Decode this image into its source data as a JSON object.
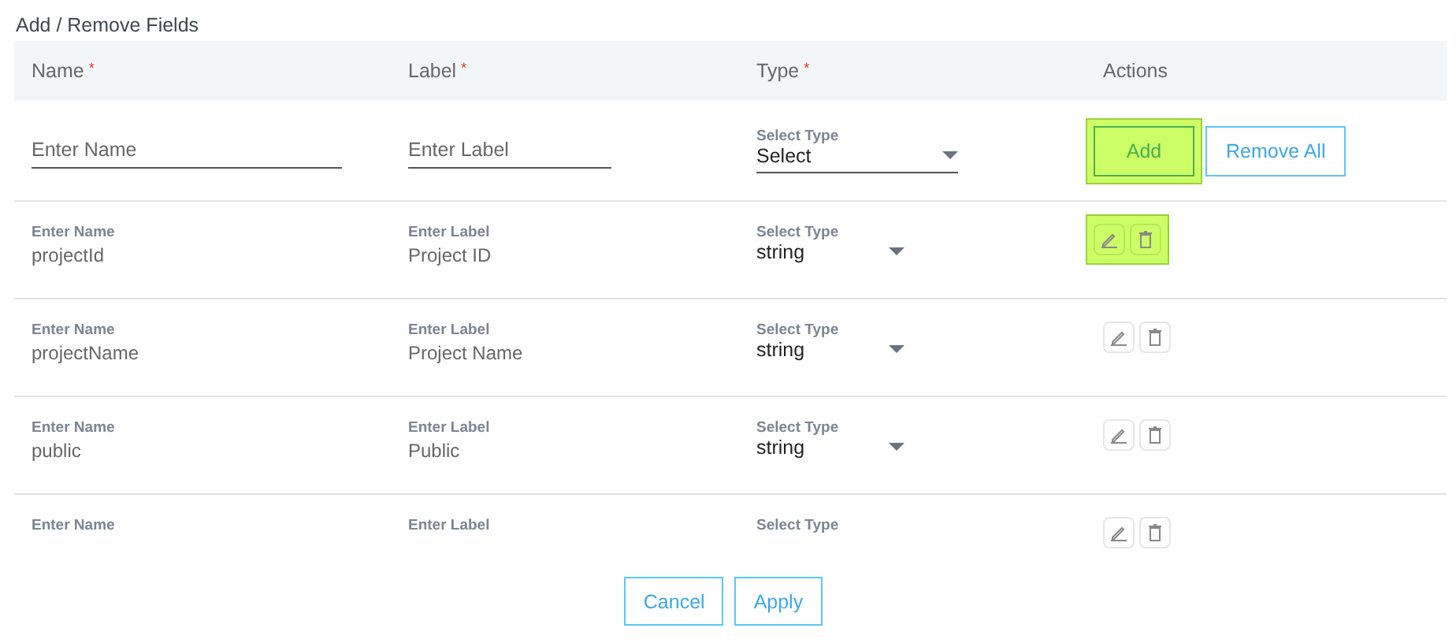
{
  "title": "Add / Remove Fields",
  "columns": [
    {
      "label": "Name",
      "mark": "*"
    },
    {
      "label": "Label",
      "mark": "*"
    },
    {
      "label": "Type",
      "mark": "*"
    },
    {
      "label": "Actions"
    }
  ],
  "new_field": {
    "name_placeholder": "Enter Name",
    "label_placeholder": "Enter Label",
    "type_label": "Select Type",
    "type_value": "Select",
    "buttons": [
      {
        "label": "Add",
        "kind": "primary",
        "highlighted": true
      },
      {
        "label": "Remove All",
        "kind": "outline",
        "highlighted": false
      }
    ]
  },
  "rows": [
    {
      "name_caption": "Enter Name",
      "name": "projectId",
      "label_caption": "Enter Label",
      "label": "Project ID",
      "type_caption": "Select Type",
      "type": "string",
      "highlighted": true
    },
    {
      "name_caption": "Enter Name",
      "name": "projectName",
      "label_caption": "Enter Label",
      "label": "Project Name",
      "type_caption": "Select Type",
      "type": "string",
      "highlighted": false
    },
    {
      "name_caption": "Enter Name",
      "name": "public",
      "label_caption": "Enter Label",
      "label": "Public",
      "type_caption": "Select Type",
      "type": "string",
      "highlighted": false
    },
    {
      "name_caption": "Enter Name",
      "label_caption": "Enter Label",
      "type_caption": "Select Type",
      "highlighted": false
    }
  ],
  "footer_buttons": [
    "Cancel",
    "Apply"
  ]
}
